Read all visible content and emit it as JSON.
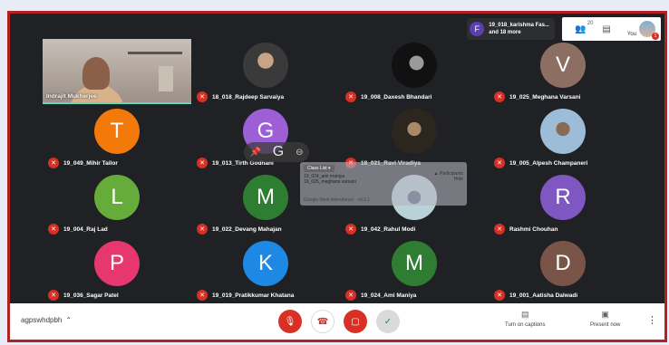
{
  "header": {
    "pinned_avatar": "F",
    "pinned_line1": "19_018_karishma Fas...",
    "pinned_line2": "and 18 more",
    "participants_count": "20",
    "you_label": "You",
    "you_badge": "1"
  },
  "main_video": {
    "name": "Indrajit Mukherjee"
  },
  "tiles": [
    {
      "name": "18_018_Rajdeep Sarvaiya",
      "initial": "",
      "color": ""
    },
    {
      "name": "19_008_Daxesh Bhandari",
      "initial": "",
      "color": ""
    },
    {
      "name": "19_025_Meghana Varsani",
      "initial": "V",
      "color": "#8d6e63"
    },
    {
      "name": "19_049_Mihir Tailor",
      "initial": "T",
      "color": "#f4790b"
    },
    {
      "name": "19_013_Tirth Godhani",
      "initial": "G",
      "color": "#9c5fd6"
    },
    {
      "name": "18_021_Ravi Viradiya",
      "initial": "",
      "color": ""
    },
    {
      "name": "19_005_Alpesh Champaneri",
      "initial": "",
      "color": ""
    },
    {
      "name": "19_004_Raj Lad",
      "initial": "L",
      "color": "#66ac3a"
    },
    {
      "name": "19_022_Devang Mahajan",
      "initial": "M",
      "color": "#2e7d32"
    },
    {
      "name": "19_042_Rahul Modi",
      "initial": "",
      "color": ""
    },
    {
      "name": "Rashmi Chouhan",
      "initial": "R",
      "color": "#7e57c2"
    },
    {
      "name": "19_036_Sagar Patel",
      "initial": "P",
      "color": "#e6386f"
    },
    {
      "name": "19_019_Pratikkumar Khatana",
      "initial": "K",
      "color": "#1e88e5"
    },
    {
      "name": "19_024_Ami Maniya",
      "initial": "M",
      "color": "#2e7d32"
    },
    {
      "name": "19_001_Aatisha Dalwadi",
      "initial": "D",
      "color": "#795548"
    }
  ],
  "popup": {
    "button": "Class List ▾",
    "line1": "19_024_ami maniya",
    "line2": "19_025_meghana varsani",
    "footer": "Google Meet Attendance - v0.2.1",
    "side1": "▲ Participants",
    "side2": "Hide"
  },
  "bottom_bar": {
    "meeting_code": "agpswhdpbh",
    "captions_label": "Turn on captions",
    "present_label": "Present now"
  }
}
